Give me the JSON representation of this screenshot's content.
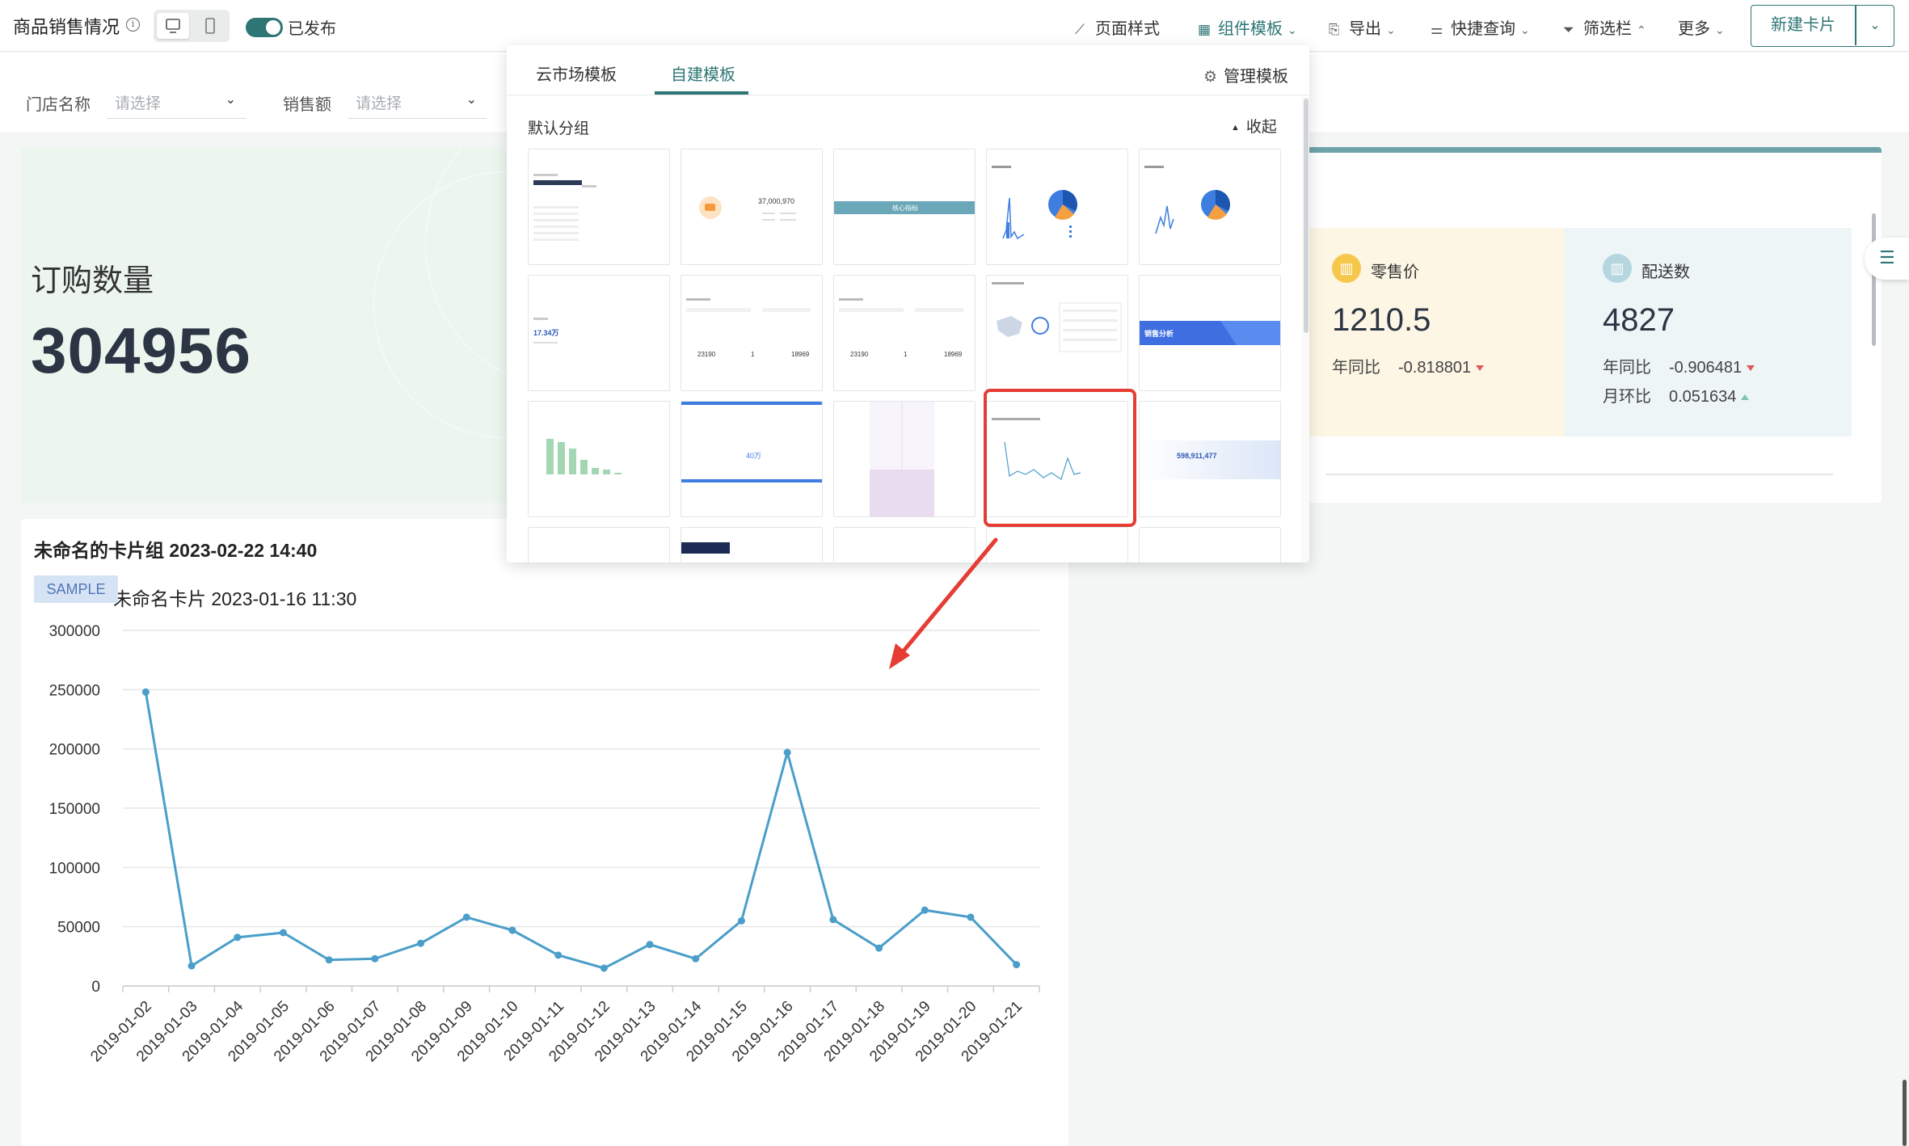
{
  "topbar": {
    "title": "商品销售情况",
    "info_icon": "info-icon",
    "published_label": "已发布",
    "tools": [
      {
        "label": "页面样式",
        "icon": "magic-wand-icon"
      },
      {
        "label": "组件模板",
        "icon": "template-grid-icon",
        "active": true
      },
      {
        "label": "导出",
        "icon": "export-icon"
      },
      {
        "label": "快捷查询",
        "icon": "sliders-icon"
      },
      {
        "label": "筛选栏",
        "icon": "funnel-icon"
      },
      {
        "label": "更多",
        "icon": "chevron-down-icon"
      }
    ],
    "new_card_label": "新建卡片"
  },
  "filters": [
    {
      "label": "门店名称",
      "placeholder": "请选择"
    },
    {
      "label": "销售额",
      "placeholder": "请选择"
    }
  ],
  "kpi_main": {
    "label": "订购数量",
    "value": "304956"
  },
  "kpis": [
    {
      "title": "零售价",
      "value": "1210.5",
      "rows": [
        {
          "label": "年同比",
          "value": "-0.818801",
          "trend": "down"
        }
      ],
      "bg": "#fdf6e4",
      "icon_bg": "#f5c84c"
    },
    {
      "title": "配送数",
      "value": "4827",
      "rows": [
        {
          "label": "年同比",
          "value": "-0.906481",
          "trend": "down"
        },
        {
          "label": "月环比",
          "value": "0.051634",
          "trend": "up"
        }
      ],
      "bg": "#eef5f6",
      "icon_bg": "#b5d6df"
    }
  ],
  "card_group": {
    "title": "未命名的卡片组 2023-02-22 14:40",
    "sample_badge": "SAMPLE",
    "chart_title": "未命名卡片 2023-01-16 11:30"
  },
  "template_modal": {
    "tabs": [
      "云市场模板",
      "自建模板"
    ],
    "active_tab": 1,
    "manage_label": "管理模板",
    "group_title": "默认分组",
    "collapse_label": "收起",
    "thumb_texts": {
      "big_num": "37,000,970",
      "kpi_label": "核心指标",
      "mini_value": "17.34万",
      "row_values": [
        "23190",
        "1",
        "18969"
      ],
      "sales_analysis": "销售分析",
      "wan": "40万",
      "total": "598,911,477"
    }
  },
  "colors": {
    "accent": "#2e7575",
    "line": "#4a9ec9",
    "highlight": "#e53c33"
  },
  "chart_data": {
    "type": "line",
    "x": [
      "2019-01-02",
      "2019-01-03",
      "2019-01-04",
      "2019-01-05",
      "2019-01-06",
      "2019-01-07",
      "2019-01-08",
      "2019-01-09",
      "2019-01-10",
      "2019-01-11",
      "2019-01-12",
      "2019-01-13",
      "2019-01-14",
      "2019-01-15",
      "2019-01-16",
      "2019-01-17",
      "2019-01-18",
      "2019-01-19",
      "2019-01-20",
      "2019-01-21"
    ],
    "series": [
      {
        "values": [
          248000,
          17000,
          41000,
          45000,
          22000,
          23000,
          36000,
          58000,
          47000,
          26000,
          15000,
          35000,
          23000,
          55000,
          197000,
          56000,
          32000,
          64000,
          58000,
          18000
        ]
      }
    ],
    "ylim": [
      0,
      300000
    ],
    "yticks": [
      0,
      50000,
      100000,
      150000,
      200000,
      250000,
      300000
    ],
    "grid": true
  }
}
